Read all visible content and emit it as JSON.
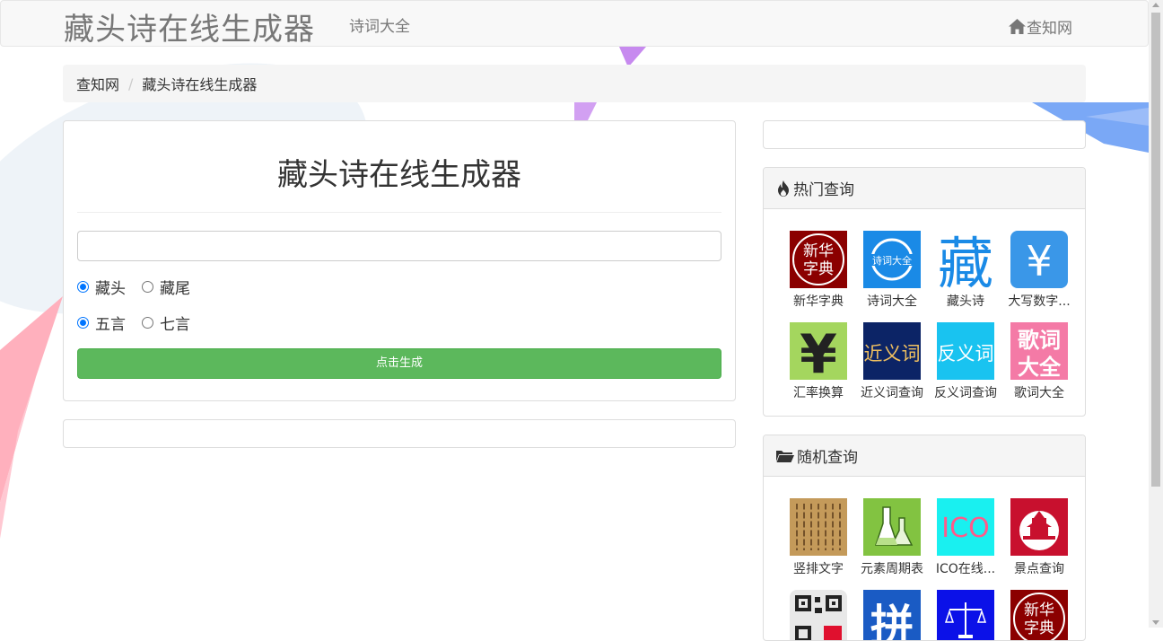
{
  "navbar": {
    "brand": "藏头诗在线生成器",
    "link": "诗词大全",
    "home_label": "查知网"
  },
  "breadcrumb": {
    "home": "查知网",
    "current": "藏头诗在线生成器"
  },
  "main": {
    "title": "藏头诗在线生成器",
    "input_value": "",
    "radio_group_1": [
      {
        "label": "藏头",
        "checked": true
      },
      {
        "label": "藏尾",
        "checked": false
      }
    ],
    "radio_group_2": [
      {
        "label": "五言",
        "checked": true
      },
      {
        "label": "七言",
        "checked": false
      }
    ],
    "generate_label": "点击生成"
  },
  "hot": {
    "title": "热门查询",
    "items": [
      {
        "label": "新华字典",
        "icon": "xinhua-dictionary-icon",
        "img_text": "新华字典",
        "bg": "#8b0000"
      },
      {
        "label": "诗词大全",
        "icon": "poetry-icon",
        "img_text": "诗词大全",
        "bg": "#1a8ae6"
      },
      {
        "label": "藏头诗",
        "icon": "cangtoushi-icon",
        "img_text": "藏",
        "bg": "#ffffff"
      },
      {
        "label": "大写数字...",
        "icon": "yen-icon",
        "img_text": "¥",
        "bg": "#3a97e8"
      },
      {
        "label": "汇率换算",
        "icon": "exchange-rate-icon",
        "img_text": "¥",
        "bg": "#a4d65e"
      },
      {
        "label": "近义词查询",
        "icon": "synonym-icon",
        "img_text": "近义词",
        "bg": "#0c2466"
      },
      {
        "label": "反义词查询",
        "icon": "antonym-icon",
        "img_text": "反义词",
        "bg": "#19c3f0"
      },
      {
        "label": "歌词大全",
        "icon": "lyrics-icon",
        "img_text": "歌词大全",
        "bg": "#f47aa6"
      }
    ]
  },
  "random": {
    "title": "随机查询",
    "items": [
      {
        "label": "竖排文字",
        "icon": "vertical-text-icon",
        "img_text": "",
        "bg": "#c49a5a"
      },
      {
        "label": "元素周期表",
        "icon": "flask-icon",
        "img_text": "",
        "bg": "#82c341"
      },
      {
        "label": "ICO在线...",
        "icon": "ico-icon",
        "img_text": "ICO",
        "bg": "#19f0f0"
      },
      {
        "label": "景点查询",
        "icon": "temple-icon",
        "img_text": "",
        "bg": "#c8102e"
      },
      {
        "label": "",
        "icon": "qr-code-icon",
        "img_text": "",
        "bg": "#e8e8e8"
      },
      {
        "label": "",
        "icon": "pinyin-icon",
        "img_text": "拼",
        "bg": "#1a5bc4"
      },
      {
        "label": "",
        "icon": "scale-icon",
        "img_text": "",
        "bg": "#0b11e8"
      },
      {
        "label": "",
        "icon": "xinhua-dictionary-icon",
        "img_text": "新华字典",
        "bg": "#8b0000"
      }
    ]
  },
  "colors": {
    "accent_green": "#5cb85c",
    "radio_blue": "#0075ff"
  }
}
